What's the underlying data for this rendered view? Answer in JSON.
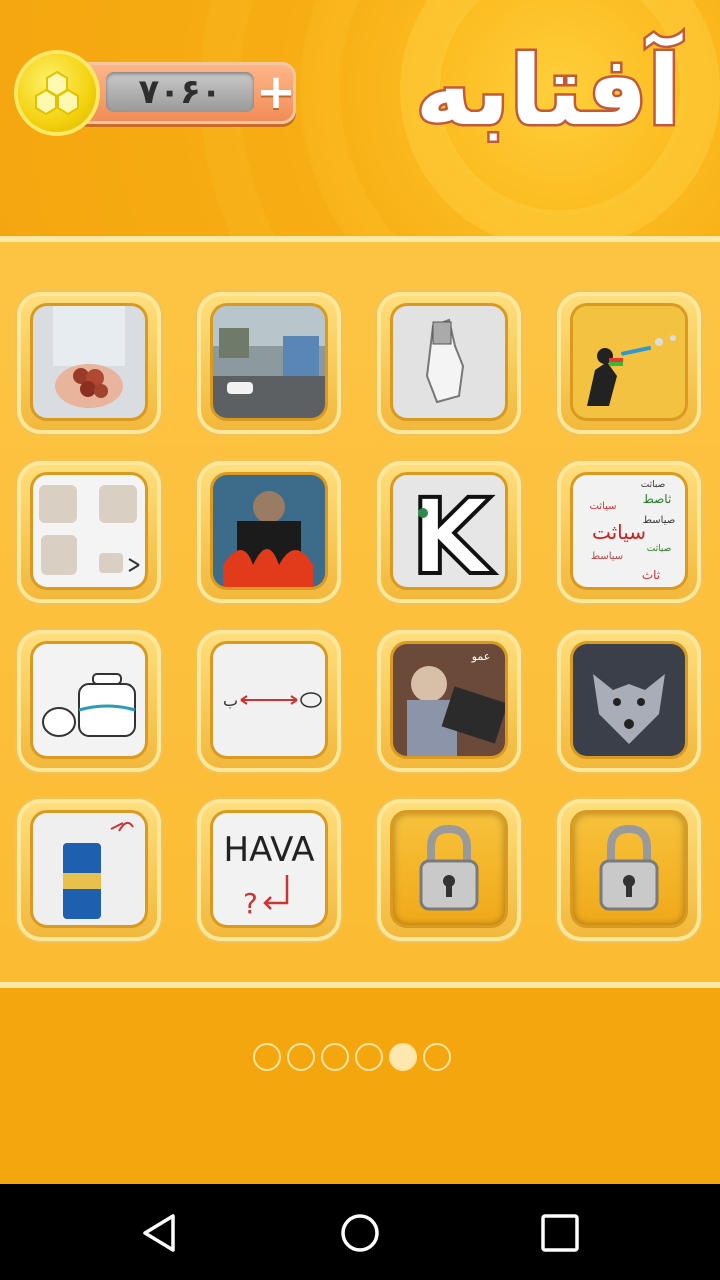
{
  "app": {
    "title": "آفتابه",
    "coins": "۷۰۶۰",
    "add_coins_label": "+"
  },
  "colors": {
    "background": "#f4a60f",
    "panel": "#fcc03a",
    "tile_border": "#ffe79a",
    "coin_bar": "#f08a55"
  },
  "levels": [
    {
      "name": "level-hands-berries",
      "icon": "photo-hands-holding-fruit",
      "locked": false
    },
    {
      "name": "level-street-painting",
      "icon": "photo-street-mural",
      "locked": false
    },
    {
      "name": "level-hand-drawing",
      "icon": "sketch-hand",
      "locked": false
    },
    {
      "name": "level-soldier-rainbow",
      "icon": "silhouette-shooting-rainbow",
      "locked": false
    },
    {
      "name": "level-bread",
      "icon": "photo-bread-pieces",
      "locked": false
    },
    {
      "name": "level-fire-figure",
      "icon": "drawing-figure-in-fire",
      "locked": false
    },
    {
      "name": "level-letter-k",
      "icon": "letter-k-with-emblem",
      "locked": false
    },
    {
      "name": "level-word-cloud",
      "icon": "persian-word-cloud",
      "locked": false
    },
    {
      "name": "level-teapot-pot",
      "icon": "sketch-teapot-and-pot",
      "locked": false
    },
    {
      "name": "level-arrow-fish",
      "icon": "arrow-between-letter-and-fish",
      "locked": false
    },
    {
      "name": "level-old-man-keyboard",
      "icon": "photo-old-man-at-keyboard",
      "locked": false
    },
    {
      "name": "level-wolf",
      "icon": "photo-wolf-in-snow",
      "locked": false
    },
    {
      "name": "level-can",
      "icon": "photo-drink-can",
      "locked": false
    },
    {
      "name": "level-hava",
      "icon": "text-hava-with-question",
      "locked": false
    },
    {
      "name": "level-locked-1",
      "icon": "padlock-icon",
      "locked": true
    },
    {
      "name": "level-locked-2",
      "icon": "padlock-icon",
      "locked": true
    }
  ],
  "tile_text": {
    "k_letter": "K",
    "hava": "HAVA",
    "uncle": "عمو",
    "word_cloud": [
      "صباثت",
      "ثاصط",
      "سیاثت",
      "صیاسط",
      "سیاثت",
      "سیاسط",
      "صیاثت",
      "ثاث"
    ]
  },
  "pager": {
    "page_count": 6,
    "current_page_index": 4
  },
  "navbar": {
    "back": "back-icon",
    "home": "home-icon",
    "recents": "recents-icon"
  }
}
